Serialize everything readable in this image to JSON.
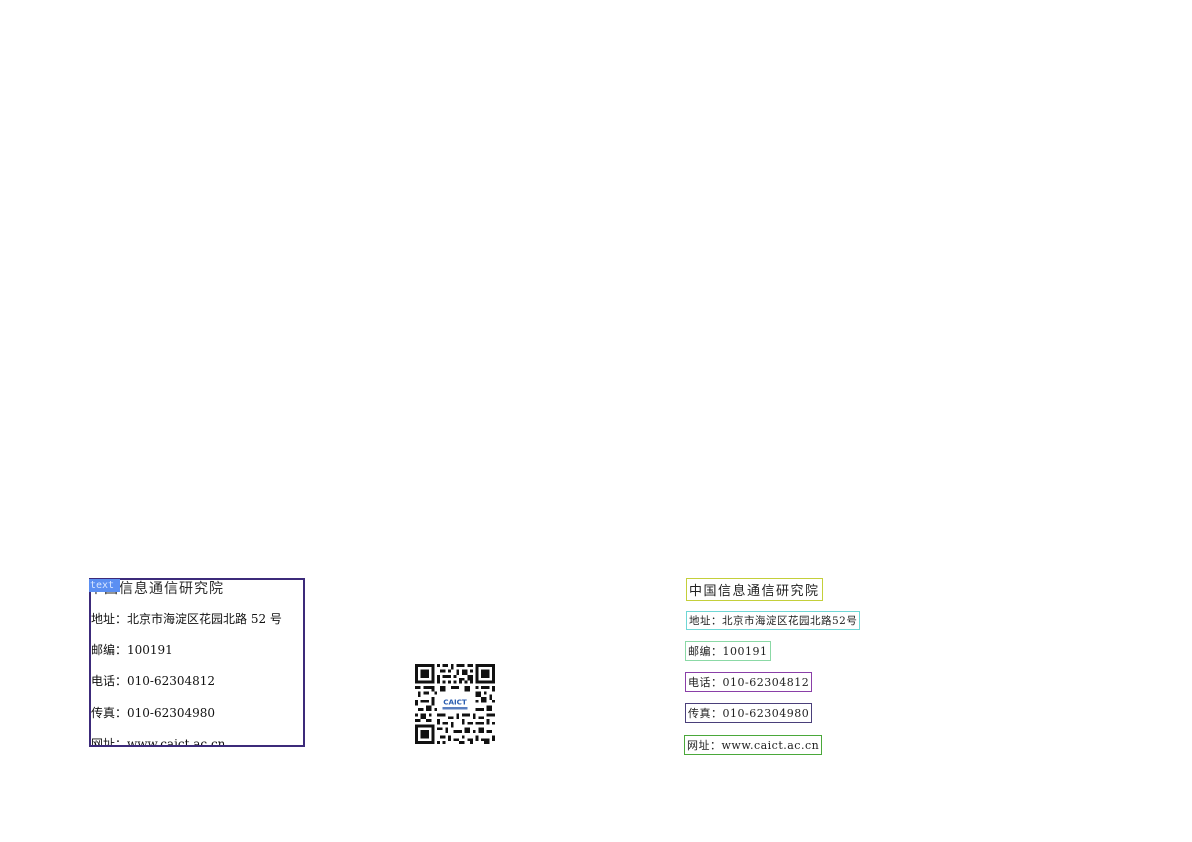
{
  "left_block": {
    "tag": "text",
    "org_name": "中国信息通信研究院",
    "address": "地址：北京市海淀区花园北路 52 号",
    "postcode": "邮编：100191",
    "phone": "电话：010-62304812",
    "fax": "传真：010-62304980",
    "website": "网址：www.caict.ac.cn"
  },
  "qr_code": {
    "logo_text": "CAICT"
  },
  "right_block": {
    "org_name": "中国信息通信研究院",
    "address": "地址：北京市海淀区花园北路52号",
    "postcode": "邮编：100191",
    "phone": "电话：010-62304812",
    "fax": "传真：010-62304980",
    "website": "网址：www.caict.ac.cn"
  },
  "colors": {
    "left_frame": "#3c2a7a",
    "tag_bg": "#5b8ff2",
    "title_box": "#c4cf3a",
    "address_box": "#6fd7d6",
    "postcode_box": "#8bd9a6",
    "phone_box": "#8a3fa8",
    "fax_box": "#4a3f7a",
    "website_box": "#4aa83a"
  }
}
